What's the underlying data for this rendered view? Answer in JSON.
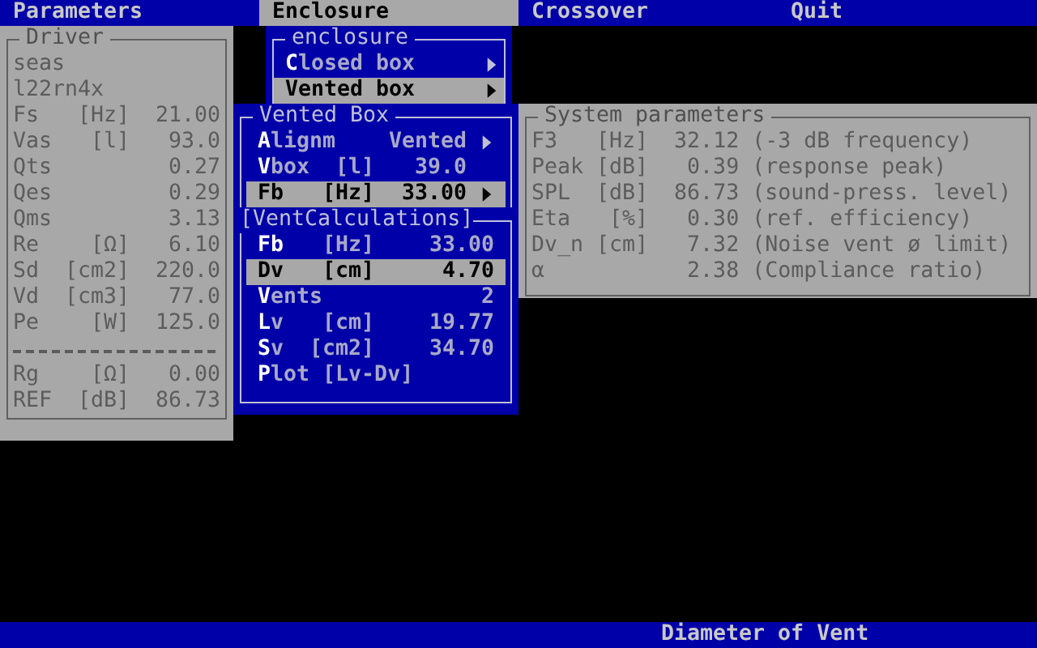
{
  "menu_bar": [
    {
      "label": "Parameters",
      "selected": false
    },
    {
      "label": "Enclosure",
      "selected": true
    },
    {
      "label": "Crossover",
      "selected": false
    },
    {
      "label": "Quit",
      "selected": false
    }
  ],
  "driver_panel": {
    "title": "Driver",
    "brand": "seas",
    "model": "l22rn4x",
    "params": [
      {
        "name": "Fs",
        "unit": "[Hz]",
        "value": "21.00"
      },
      {
        "name": "Vas",
        "unit": "[l]",
        "value": "93.0"
      },
      {
        "name": "Qts",
        "value": "0.27"
      },
      {
        "name": "Qes",
        "value": "0.29"
      },
      {
        "name": "Qms",
        "value": "3.13"
      },
      {
        "name": "Re",
        "unit": "[Ω]",
        "value": "6.10"
      },
      {
        "name": "Sd",
        "unit": "[cm2]",
        "value": "220.0"
      },
      {
        "name": "Vd",
        "unit": "[cm3]",
        "value": "77.0"
      },
      {
        "name": "Pe",
        "unit": "[W]",
        "value": "125.0"
      }
    ],
    "extra_params": [
      {
        "name": "Rg",
        "unit": "[Ω]",
        "value": "0.00"
      },
      {
        "name": "REF",
        "unit": "[dB]",
        "value": "86.73"
      }
    ]
  },
  "enclosure_menu": {
    "title": "enclosure",
    "items": [
      {
        "label": "**C**losed box",
        "selected": false,
        "submenu": true
      },
      {
        "label": "**V**ented box",
        "selected": true,
        "submenu": true
      }
    ]
  },
  "vented_box": {
    "title": "Vented Box",
    "items": [
      {
        "label": "**A**lignm",
        "value": "Vented",
        "selected": false,
        "submenu": true
      },
      {
        "label": "**V**box",
        "unit": "[l]",
        "value": "39.0",
        "selected": false,
        "submenu": false
      },
      {
        "label": "**Fb**",
        "unit": "[Hz]",
        "value": "33.00",
        "selected": true,
        "submenu": true
      }
    ]
  },
  "vent_calculations": {
    "title": "[VentCalculations]",
    "items": [
      {
        "kind": "value",
        "label": "**Fb**",
        "unit": "[Hz]",
        "value": "33.00",
        "selected": false
      },
      {
        "kind": "value",
        "label": "**D**v",
        "unit": "[cm]",
        "value": "4.70",
        "selected": true
      },
      {
        "kind": "value",
        "label": "**V**ents",
        "value": "2",
        "selected": false
      },
      {
        "kind": "value",
        "label": "**L**v",
        "unit": "[cm]",
        "value": "19.77",
        "selected": false
      },
      {
        "kind": "value",
        "label": "**S**v",
        "unit": "[cm2]",
        "value": "34.70",
        "selected": false
      },
      {
        "kind": "action",
        "label": "**P**lot [Lv-Dv]",
        "selected": false
      }
    ]
  },
  "system_parameters": {
    "title": "System parameters",
    "rows": [
      {
        "name": "F3",
        "unit": "[Hz]",
        "value": "32.12",
        "note": "(-3 dB frequency)"
      },
      {
        "name": "Peak",
        "unit": "[dB]",
        "value": "0.39",
        "note": "(response peak)"
      },
      {
        "name": "SPL",
        "unit": "[dB]",
        "value": "86.73",
        "note": "(sound-press. level)"
      },
      {
        "name": "Eta",
        "unit": "[%]",
        "value": "0.30",
        "note": "(ref. efficiency)"
      },
      {
        "name": "Dv_n",
        "unit": "[cm]",
        "value": "7.32",
        "note": "(Noise vent ø limit)"
      },
      {
        "name": "α",
        "value": "2.38",
        "note": "(Compliance ratio)"
      }
    ]
  },
  "status_bar": {
    "text": "Diameter of Vent"
  }
}
